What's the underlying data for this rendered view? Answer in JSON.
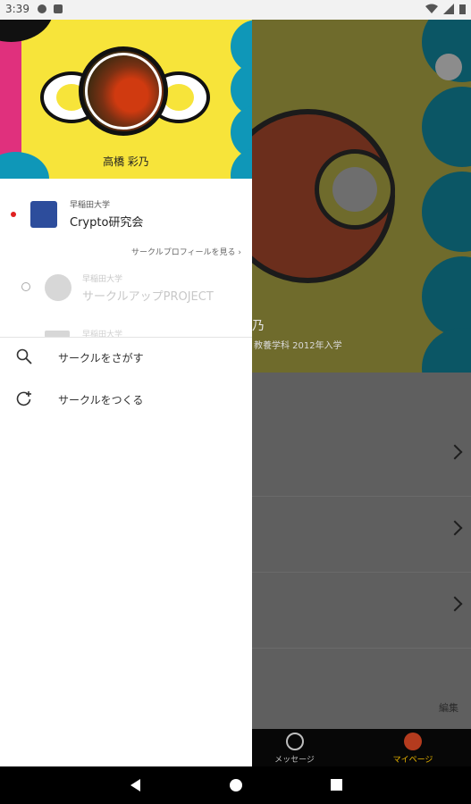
{
  "status": {
    "time": "3:39"
  },
  "drawer": {
    "user_name": "高橋 彩乃",
    "circles": [
      {
        "university": "早稲田大学",
        "name": "Crypto研究会",
        "selected": true
      },
      {
        "university": "早稲田大学",
        "name": "サークルアップPROJECT",
        "selected": false
      },
      {
        "university": "早稲田大学",
        "name": "",
        "selected": false
      }
    ],
    "profile_link": "サークルプロフィールを見る ›",
    "actions": [
      {
        "label": "サークルをさがす",
        "icon": "search-icon"
      },
      {
        "label": "サークルをつくる",
        "icon": "create-circle-icon"
      }
    ]
  },
  "main": {
    "name_partial": "乃",
    "subtitle_partial": "教養学科 2012年入学",
    "edit_label": "編集",
    "tabs": [
      {
        "label": "メッセージ",
        "icon": "message-icon",
        "active": false
      },
      {
        "label": "マイページ",
        "icon": "mypage-avatar-icon",
        "active": true
      }
    ]
  },
  "colors": {
    "header_yellow": "#f7e43a",
    "header_blue": "#0f97b8",
    "accent_pink": "#e0307d",
    "active_tab": "#e8b400",
    "selected_dot": "#e02020"
  }
}
